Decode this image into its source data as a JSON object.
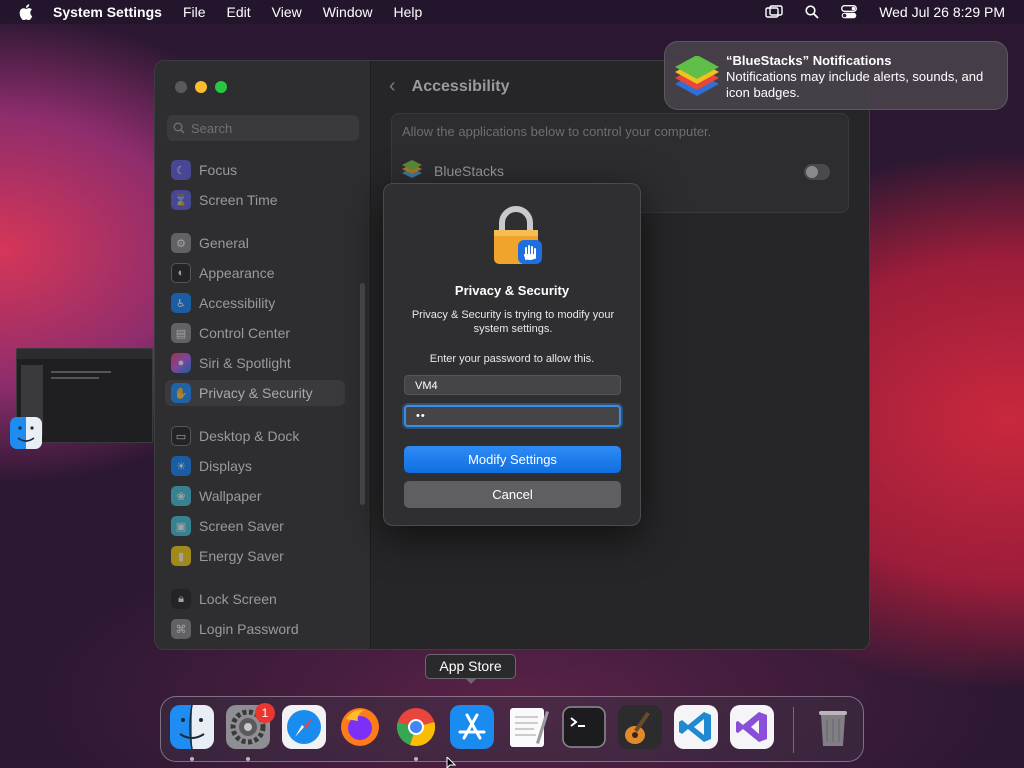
{
  "menubar": {
    "app_name": "System Settings",
    "menus": [
      "File",
      "Edit",
      "View",
      "Window",
      "Help"
    ],
    "datetime": "Wed Jul 26  8:29 PM"
  },
  "sidebar": {
    "search_placeholder": "Search",
    "groups": [
      [
        {
          "label": "Focus",
          "icon": "moon-icon",
          "color": "#5d5ce6"
        },
        {
          "label": "Screen Time",
          "icon": "hourglass-icon",
          "color": "#5d5ce6"
        }
      ],
      [
        {
          "label": "General",
          "icon": "gear-icon",
          "color": "#8e8e93"
        },
        {
          "label": "Appearance",
          "icon": "appearance-icon",
          "color": "#1c1c1e"
        },
        {
          "label": "Accessibility",
          "icon": "accessibility-icon",
          "color": "#0a84ff"
        },
        {
          "label": "Control Center",
          "icon": "control-center-icon",
          "color": "#8e8e93"
        },
        {
          "label": "Siri & Spotlight",
          "icon": "siri-icon",
          "color": "#bf5af2"
        },
        {
          "label": "Privacy & Security",
          "icon": "hand-icon",
          "color": "#0a84ff",
          "active": true
        }
      ],
      [
        {
          "label": "Desktop & Dock",
          "icon": "desktop-icon",
          "color": "#1c1c1e"
        },
        {
          "label": "Displays",
          "icon": "sun-icon",
          "color": "#0a84ff"
        },
        {
          "label": "Wallpaper",
          "icon": "wallpaper-icon",
          "color": "#40c8e0"
        },
        {
          "label": "Screen Saver",
          "icon": "screen-saver-icon",
          "color": "#40c8e0"
        },
        {
          "label": "Energy Saver",
          "icon": "battery-icon",
          "color": "#ffd60a"
        }
      ],
      [
        {
          "label": "Lock Screen",
          "icon": "lock-icon",
          "color": "#1c1c1e"
        },
        {
          "label": "Login Password",
          "icon": "login-icon",
          "color": "#8e8e93"
        }
      ]
    ]
  },
  "content": {
    "title": "Accessibility",
    "description": "Allow the applications below to control your computer.",
    "app_name": "BlueStacks",
    "toggle_on": false
  },
  "dialog": {
    "title": "Privacy & Security",
    "message": "Privacy & Security is trying to modify your system settings.",
    "prompt": "Enter your password to allow this.",
    "username": "VM4",
    "password_mask": "••",
    "primary_button": "Modify Settings",
    "secondary_button": "Cancel"
  },
  "notification": {
    "title": "“BlueStacks” Notifications",
    "body": "Notifications may include alerts, sounds, and icon badges."
  },
  "tooltip": {
    "label": "App Store"
  },
  "dock": {
    "apps": [
      {
        "name": "Finder",
        "icon": "finder-icon",
        "running": true
      },
      {
        "name": "System Settings",
        "icon": "system-settings-icon",
        "running": true,
        "badge": "1"
      },
      {
        "name": "Safari",
        "icon": "safari-icon",
        "running": false
      },
      {
        "name": "Firefox",
        "icon": "firefox-icon",
        "running": false
      },
      {
        "name": "Chrome",
        "icon": "chrome-icon",
        "running": true
      },
      {
        "name": "App Store",
        "icon": "app-store-icon",
        "running": false
      },
      {
        "name": "TextEdit",
        "icon": "textedit-icon",
        "running": false
      },
      {
        "name": "Terminal",
        "icon": "terminal-icon",
        "running": false
      },
      {
        "name": "GarageBand",
        "icon": "garageband-icon",
        "running": false
      },
      {
        "name": "Visual Studio Code",
        "icon": "vscode-icon",
        "running": false
      },
      {
        "name": "Visual Studio",
        "icon": "visual-studio-icon",
        "running": false
      },
      {
        "name": "Trash",
        "icon": "trash-icon",
        "running": false
      }
    ]
  }
}
